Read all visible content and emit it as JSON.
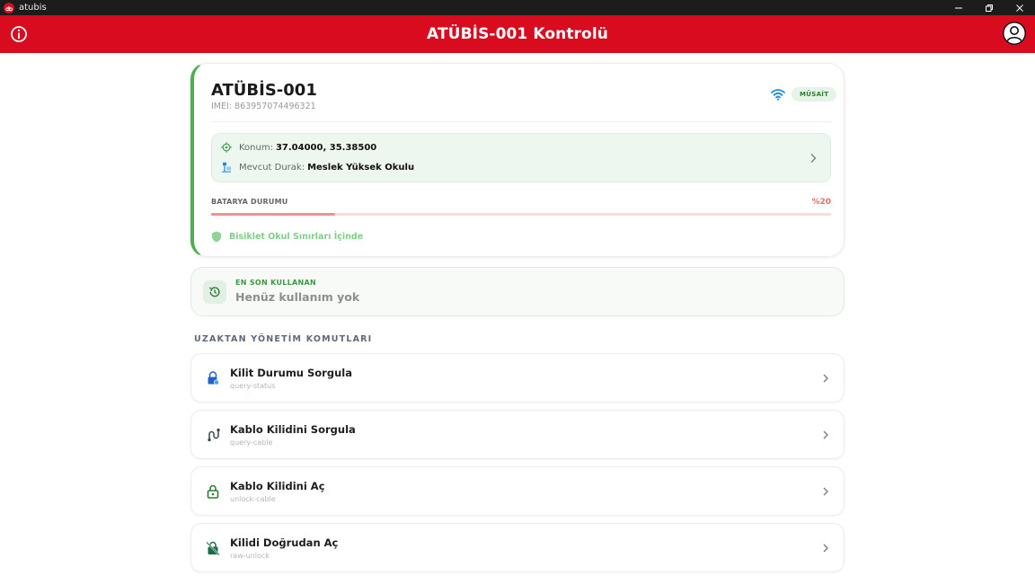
{
  "window": {
    "app_name": "atubis"
  },
  "header": {
    "title": "ATÜBİS-001 Kontrolü"
  },
  "device": {
    "name": "ATÜBİS-001",
    "imei": "IMEI: 863957074496321",
    "status": "MÜSAİT",
    "location_label": "Konum:",
    "location_value": "37.04000, 35.38500",
    "stop_label": "Mevcut Durak:",
    "stop_value": "Meslek Yüksek Okulu",
    "battery_label": "BATARYA DURUMU",
    "battery_percent_text": "%20",
    "battery_level": 0.2,
    "boundary_text": "Bisiklet Okul Sınırları İçinde"
  },
  "last_user": {
    "label": "EN SON KULLANAN",
    "value": "Henüz kullanım yok"
  },
  "commands_section": {
    "title": "UZAKTAN YÖNETİM KOMUTLARI",
    "items": [
      {
        "label": "Kilit Durumu Sorgula",
        "code": "query-status",
        "icon": "lock-status-icon"
      },
      {
        "label": "Kablo Kilidini Sorgula",
        "code": "query-cable",
        "icon": "cable-icon"
      },
      {
        "label": "Kablo Kilidini Aç",
        "code": "unlock-cable",
        "icon": "unlock-icon"
      },
      {
        "label": "Kilidi Doğrudan Aç",
        "code": "raw-unlock",
        "icon": "no-lock-icon"
      }
    ]
  },
  "colors": {
    "brand_red": "#d90b1f",
    "success_green": "#4caf50",
    "battery_red": "#ef9191"
  }
}
